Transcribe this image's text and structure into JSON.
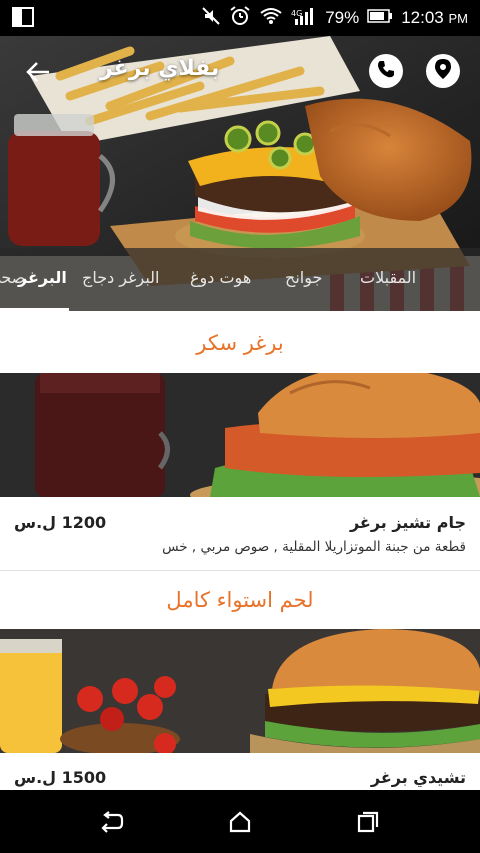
{
  "status": {
    "battery_percent": "79%",
    "time": "12:03",
    "ampm": "PM"
  },
  "header": {
    "title": "بفلاي برغر"
  },
  "tabs": [
    {
      "label": "صحي"
    },
    {
      "label": "المقبلات"
    },
    {
      "label": "جوانح"
    },
    {
      "label": "هوت دوغ"
    },
    {
      "label": "البرغر دجاج"
    },
    {
      "label": "البرغر"
    }
  ],
  "sections": [
    {
      "title": "برغر سكر",
      "item": {
        "name": "جام تشيز برغر",
        "price": "1200 ل.س",
        "description": "قطعة من جبنة الموتزاريلا المقلية , صوص مربي , خس"
      }
    },
    {
      "title": "لحم استواء كامل",
      "item": {
        "name": "تشيدي برغر",
        "price": "1500 ل.س"
      }
    }
  ],
  "colors": {
    "accent": "#e8732a",
    "statusbar": "#000000"
  }
}
